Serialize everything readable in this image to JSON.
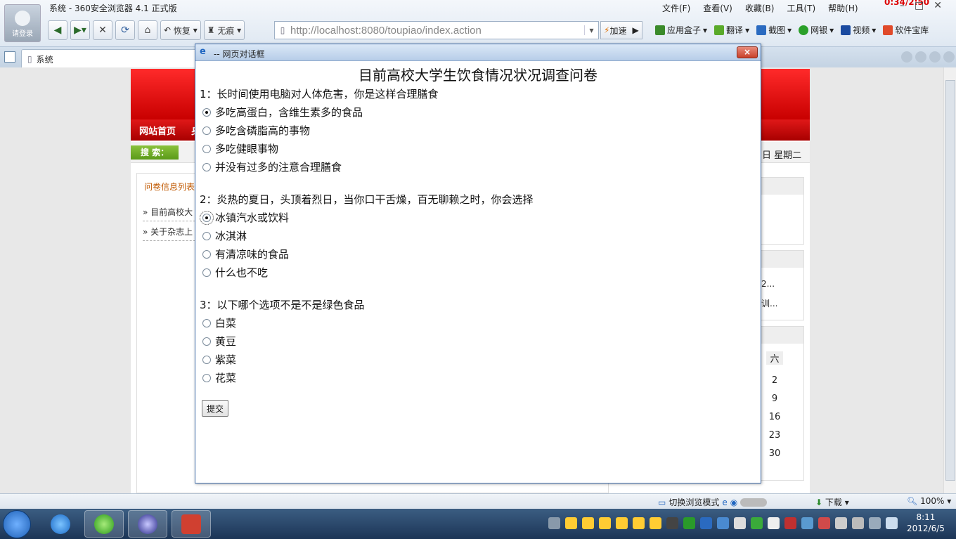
{
  "browser": {
    "window_title": "系统 - 360安全浏览器 4.1 正式版",
    "avatar_label": "请登录",
    "menu": [
      "文件(F)",
      "查看(V)",
      "收藏(B)",
      "工具(T)",
      "帮助(H)"
    ],
    "timer": "0:34/2:50",
    "nav": {
      "restore": "恢复",
      "trace": "无痕"
    },
    "address_url": "http://localhost:8080/toupiao/index.action",
    "speed": "加速",
    "toolbar": [
      "应用盒子",
      "翻译",
      "截图",
      "网银",
      "视频",
      "软件宝库"
    ],
    "tab_title": "系统"
  },
  "site": {
    "nav_home": "网站首页",
    "nav_second": "身",
    "search_label": "搜 索：",
    "weekday": "日 星期二",
    "list_header": "问卷信息列表",
    "list_items": [
      "目前高校大",
      "关于杂志上"
    ],
    "right_snippets": [
      "2...",
      "训..."
    ],
    "calendar_head": "六",
    "calendar_days": [
      "2",
      "9",
      "16",
      "23",
      "30"
    ]
  },
  "dialog": {
    "title": "-- 网页对话框",
    "close_label": "×",
    "survey_title": "目前高校大学生饮食情况状况调查问卷",
    "questions": [
      {
        "text": "1：长时间使用电脑对人体危害，你是这样合理膳食",
        "options": [
          "多吃高蛋白，含维生素多的食品",
          "多吃含磷脂高的事物",
          "多吃健眼事物",
          "并没有过多的注意合理膳食"
        ],
        "selected": 0
      },
      {
        "text": "2：炎热的夏日，头顶着烈日，当你口干舌燥，百无聊赖之时，你会选择",
        "options": [
          "冰镇汽水或饮料",
          "冰淇淋",
          "有清凉味的食品",
          "什么也不吃"
        ],
        "selected": 0
      },
      {
        "text": "3：以下哪个选项不是不是绿色食品",
        "options": [
          "白菜",
          "黄豆",
          "紫菜",
          "花菜"
        ],
        "selected": null
      }
    ],
    "submit_label": "提交"
  },
  "statusbar": {
    "mode_switch": "切换浏览模式",
    "download": "下载",
    "zoom": "100%"
  },
  "taskbar": {
    "time": "8:11",
    "date": "2012/6/5"
  }
}
